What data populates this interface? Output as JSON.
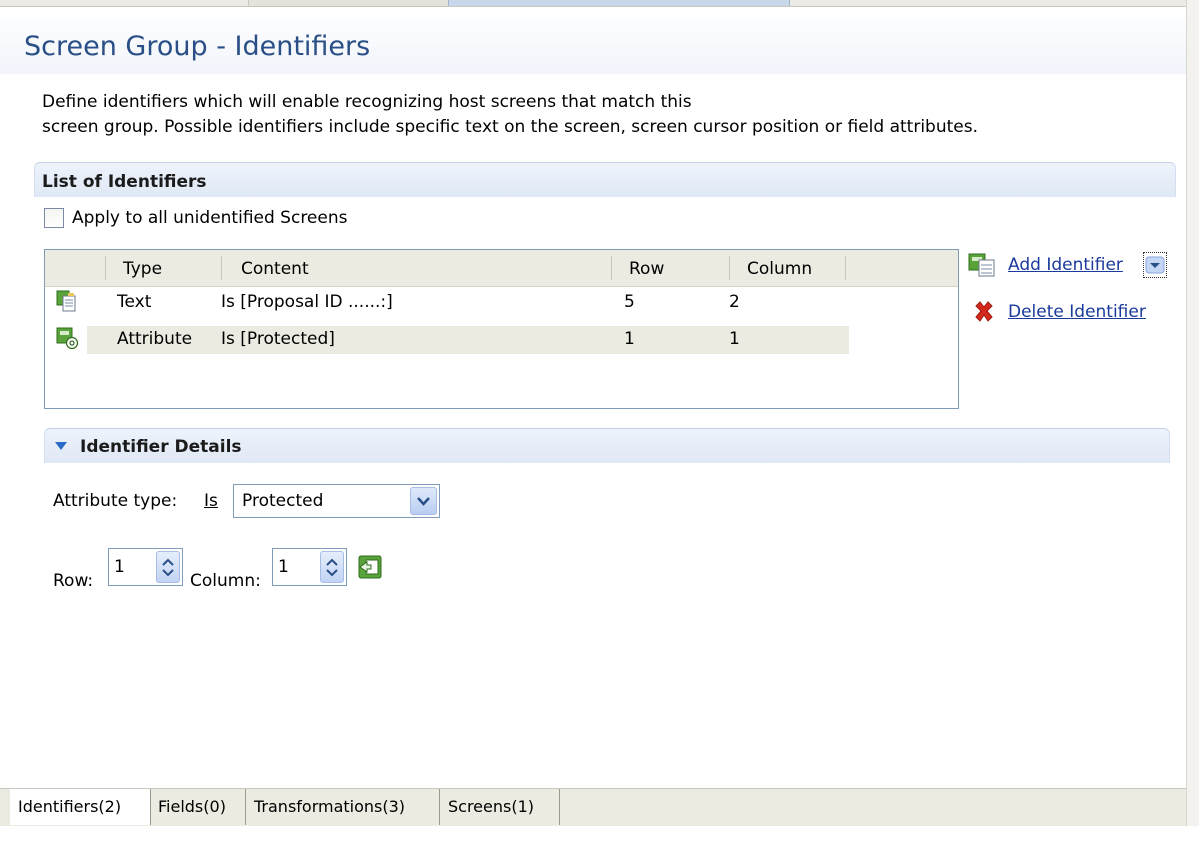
{
  "page": {
    "title": "Screen Group - Identifiers",
    "description_line1": "Define identifiers which will enable recognizing host screens that match this",
    "description_line2": "screen group. Possible identifiers include specific text on the screen, screen cursor position or field attributes."
  },
  "list_section": {
    "title": "List of Identifiers",
    "apply_all_label": "Apply to all unidentified Screens",
    "apply_all_checked": false,
    "columns": [
      "Type",
      "Content",
      "Row",
      "Column"
    ],
    "rows": [
      {
        "icon": "text-identifier-icon",
        "type": "Text",
        "content": "Is [Proposal ID ......:]",
        "row": "5",
        "column": "2",
        "selected": false
      },
      {
        "icon": "attribute-identifier-icon",
        "type": "Attribute",
        "content": "Is [Protected]",
        "row": "1",
        "column": "1",
        "selected": true
      }
    ],
    "actions": {
      "add_label": "Add Identifier",
      "delete_label": "Delete Identifier"
    }
  },
  "details_section": {
    "title": "Identifier Details",
    "attribute_type_label": "Attribute type:",
    "is_label": "Is",
    "attribute_value": "Protected",
    "row_label": "Row:",
    "row_value": "1",
    "column_label": "Column:",
    "column_value": "1"
  },
  "bottom_tabs": [
    {
      "label": "Identifiers(2)",
      "active": true
    },
    {
      "label": "Fields(0)",
      "active": false
    },
    {
      "label": "Transformations(3)",
      "active": false
    },
    {
      "label": "Screens(1)",
      "active": false
    }
  ],
  "colors": {
    "title_blue": "#2a4f86",
    "link_blue": "#1a3a9c",
    "selection": "#ecebe1",
    "delete_red": "#d4281c"
  }
}
